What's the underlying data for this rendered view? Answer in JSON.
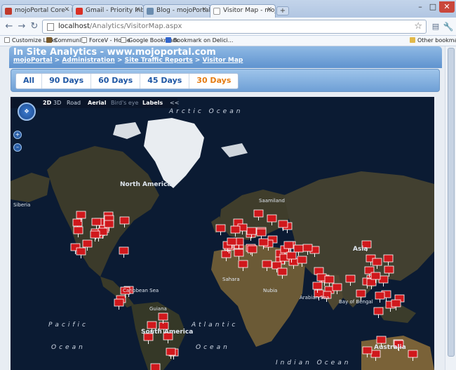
{
  "browser": {
    "tabs": [
      {
        "label": "mojoPortal Core - Pivotal...",
        "icon": "pivotal-icon",
        "color": "#c0392b"
      },
      {
        "label": "Gmail - Priority Inbox - jo...",
        "icon": "gmail-icon",
        "color": "#d93025"
      },
      {
        "label": "Blog - mojoPortal",
        "icon": "blog-icon",
        "color": "#6a8caf"
      },
      {
        "label": "Visitor Map - mojoPortal",
        "icon": "page-icon",
        "color": "#ffffff"
      }
    ],
    "new_tab": "+",
    "window_controls": {
      "minimize": "–",
      "maximize": "□",
      "close": "✕"
    },
    "nav": {
      "back": "←",
      "forward": "→",
      "reload": "↻"
    },
    "url_host": "localhost",
    "url_path": "/Analytics/VisitorMap.aspx",
    "bookmarks": [
      {
        "label": "Customize Links",
        "icon": "page-icon"
      },
      {
        "label": "Community",
        "icon": "community-icon"
      },
      {
        "label": "ForceV - Home",
        "icon": "page-icon"
      },
      {
        "label": "Google Bookmark",
        "icon": "page-icon"
      },
      {
        "label": "Bookmark on Delici...",
        "icon": "delicious-icon"
      }
    ],
    "other_bookmarks": "Other bookmarks"
  },
  "page": {
    "title": "In Site Analytics - www.mojoportal.com",
    "breadcrumb": [
      {
        "label": "mojoPortal"
      },
      {
        "label": "Administration"
      },
      {
        "label": "Site Traffic Reports"
      },
      {
        "label": "Visitor Map"
      }
    ],
    "breadcrumb_sep": " > ",
    "day_tabs": [
      {
        "label": "All",
        "selected": false
      },
      {
        "label": "90 Days",
        "selected": false
      },
      {
        "label": "60 Days",
        "selected": false
      },
      {
        "label": "45 Days",
        "selected": false
      },
      {
        "label": "30 Days",
        "selected": true
      }
    ]
  },
  "map": {
    "toolbar": {
      "mode_2d": "2D",
      "mode_3d": "3D",
      "road": "Road",
      "aerial": "Aerial",
      "birds_eye": "Bird's eye",
      "labels": "Labels",
      "collapse": "<<"
    },
    "labels": {
      "arctic": "Arctic  Ocean",
      "north_america": "North America",
      "siberia": "Siberia",
      "saamiland": "Saamiland",
      "asia": "Asia",
      "sahara": "Sahara",
      "nubia": "Nubia",
      "arabian_sea": "Arabian Sea",
      "bay_of_bengal": "Bay of Bengal",
      "caribbean_sea": "Caribbean Sea",
      "guiana": "Guiana",
      "south_america": "South America",
      "pacific": "Pacific",
      "atlantic": "Atlantic",
      "ocean_1": "Ocean",
      "ocean_2": "Ocean",
      "indian_ocean": "Indian Ocean",
      "australia": "Australia"
    },
    "pin_color": "#d0181c",
    "ocean_color": "#0b1b33",
    "land_color": "#3b3a2a",
    "ice_color": "#e9edf1"
  }
}
